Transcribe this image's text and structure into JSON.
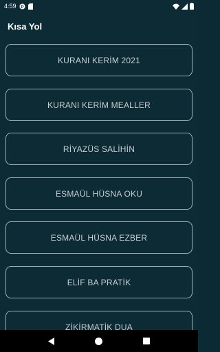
{
  "status_bar": {
    "time": "4:59",
    "icons": [
      "app-notification-icon",
      "sd-card-icon",
      "wifi-icon",
      "signal-icon",
      "battery-icon"
    ]
  },
  "app_bar": {
    "title": "Kısa Yol"
  },
  "menu": {
    "items": [
      {
        "label": "KURANI KERİM 2021"
      },
      {
        "label": "KURANI KERİM MEALLER"
      },
      {
        "label": "RİYAZÜS SALİHİN"
      },
      {
        "label": "ESMAÜL HÜSNA OKU"
      },
      {
        "label": "ESMAÜL HÜSNA EZBER"
      },
      {
        "label": "ELİF BA PRATİK"
      },
      {
        "label": "ZİKİRMATİK DUA"
      }
    ]
  },
  "nav_bar": {
    "icons": [
      "back-icon",
      "home-icon",
      "recents-icon"
    ]
  },
  "colors": {
    "background": "#0d2b35",
    "button_border": "#9fb3b8",
    "button_text": "#c5ced1",
    "text_primary": "#ffffff"
  }
}
